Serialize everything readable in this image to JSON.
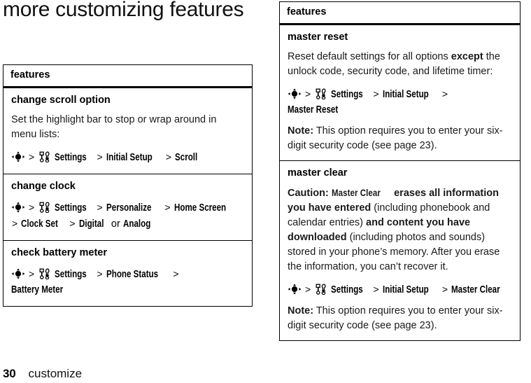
{
  "page": {
    "title": "more customizing features",
    "number": "30",
    "chapter": "customize"
  },
  "icons": {
    "nav": "navigation-key-icon",
    "settings": "settings-wrench-icon"
  },
  "left_table": {
    "header": "features",
    "rows": [
      {
        "title": "change scroll option",
        "body": "Set the highlight bar to stop or wrap around in menu lists:",
        "path": [
          "Settings",
          "Initial Setup",
          "Scroll"
        ]
      },
      {
        "title": "change clock",
        "path": [
          "Settings",
          "Personalize",
          "Home Screen",
          "Clock Set"
        ],
        "path_tail_sep": ">",
        "path_tail_a": "Digital",
        "path_tail_or": "or",
        "path_tail_b": "Analog"
      },
      {
        "title": "check battery meter",
        "path": [
          "Settings",
          "Phone Status",
          "Battery Meter"
        ]
      }
    ]
  },
  "right_table": {
    "header": "features",
    "rows": [
      {
        "title": "master reset",
        "body_pre": "Reset default settings for all options ",
        "body_bold": "except",
        "body_post": " the unlock code, security code, and lifetime timer:",
        "path": [
          "Settings",
          "Initial Setup",
          "Master Reset"
        ],
        "note_label": "Note:",
        "note_text": " This option requires you to enter your six-digit security code (see page 23)."
      },
      {
        "title": "master clear",
        "caution_label": "Caution:",
        "caution_menu": "Master Clear",
        "caution_b1": " erases all information you have entered ",
        "caution_p1": "(including phonebook and calendar entries)",
        "caution_b2": " and content you have downloaded ",
        "caution_p2": "(including photos and sounds) stored in your phone’s memory. After you erase the information, you can’t recover it.",
        "path": [
          "Settings",
          "Initial Setup",
          "Master Clear"
        ],
        "note_label": "Note:",
        "note_text": " This option requires you to enter your six-digit security code (see page 23)."
      }
    ]
  },
  "symbols": {
    "gt": ">"
  },
  "colors": {
    "text": "#000000",
    "background": "#ffffff",
    "rule": "#000000"
  }
}
